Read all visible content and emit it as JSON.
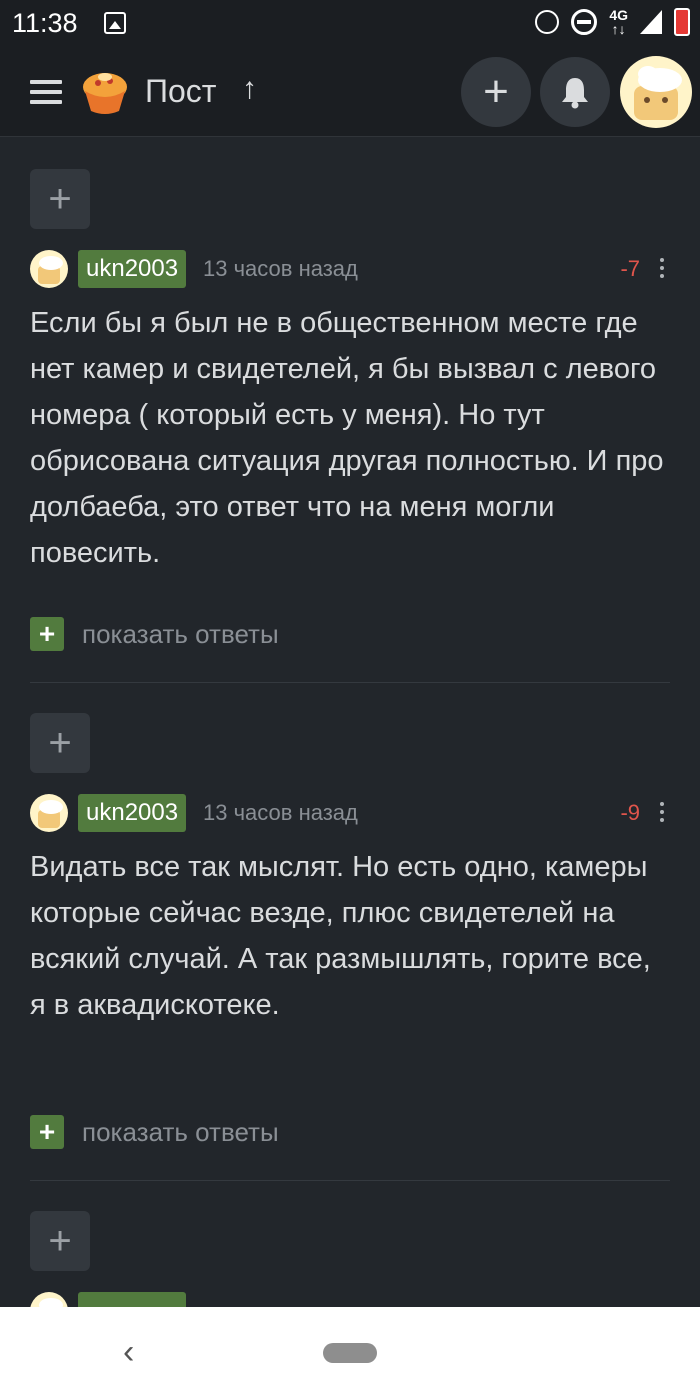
{
  "status_bar": {
    "time": "11:38",
    "network": "4G",
    "network_arrows": "↑↓",
    "icons": [
      "image-icon",
      "alarm-icon",
      "do-not-disturb-icon",
      "signal-icon",
      "battery-icon"
    ]
  },
  "top_bar": {
    "title": "Пост",
    "icons": [
      "menu-icon",
      "logo-icon",
      "arrow-up-icon",
      "plus-icon",
      "bell-icon",
      "avatar"
    ]
  },
  "comments": [
    {
      "username": "ukn2003",
      "time_ago": "13 часов назад",
      "rating": "-7",
      "text": "Если бы я был не в общественном месте где нет камер и свидетелей, я бы вызвал с левого номера ( который есть у меня). Но тут обрисована ситуация другая полностью. И про долбаеба, это ответ что на меня могли повесить.",
      "show_replies": "показать ответы"
    },
    {
      "username": "ukn2003",
      "time_ago": "13 часов назад",
      "rating": "-9",
      "text": "Видать все так мыслят. Но есть одно, камеры которые сейчас везде, плюс свидетелей на всякий случай. А так размышлять, горите все, я в аквадискотеке.",
      "show_replies": "показать ответы"
    }
  ],
  "expand_symbol": "+",
  "nav_bar": {
    "back_symbol": "‹"
  },
  "colors": {
    "background": "#22262b",
    "header": "#1b1e22",
    "username_badge": "#527b3e",
    "negative_rating": "#e0554c",
    "muted_text": "#8a8f95"
  }
}
